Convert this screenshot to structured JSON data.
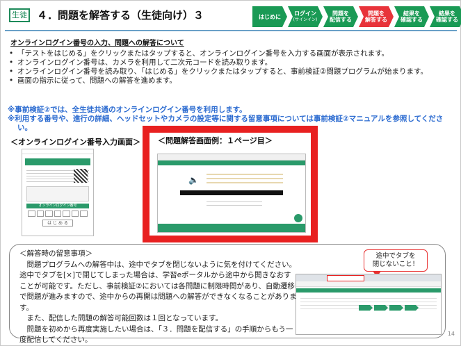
{
  "header": {
    "tag": "生徒",
    "title": "４．問題を解答する（生徒向け）３",
    "steps": [
      {
        "label": "はじめに",
        "sub": "",
        "active": false
      },
      {
        "label": "ログイン",
        "sub": "(サインイン)",
        "active": false
      },
      {
        "label": "問題を\n配信する",
        "sub": "",
        "active": false
      },
      {
        "label": "問題を\n解答する",
        "sub": "",
        "active": true
      },
      {
        "label": "結果を\n確認する",
        "sub": "",
        "active": false
      },
      {
        "label": "結果を\n確認する",
        "sub": "",
        "active": false
      }
    ]
  },
  "subtitle": "オンラインログイン番号の入力、問題への解答について",
  "bullets": [
    "「テストをはじめる」をクリックまたはタップすると、オンラインログイン番号を入力する画面が表示されます。",
    "オンラインログイン番号は、カメラを利用して二次元コードを読み取ります。",
    "オンラインログイン番号を読み取り、「はじめる」をクリックまたはタップすると、事前検証②問題プログラムが始まります。",
    "画面の指示に従って、問題への解答を進めます。"
  ],
  "notes": [
    "※事前検証②では、全生徒共通のオンラインログイン番号を利用します。",
    "※利用する番号や、進行の詳細、ヘッドセットやカメラの設定等に関する留意事項については事前検証②マニュアルを参照してください。"
  ],
  "labels": {
    "login_screen": "＜オンラインログイン番号入力画面＞",
    "question_screen": "＜問題解答画面例：１ページ目＞"
  },
  "phone": {
    "header": "オンラインログイン番号",
    "start_button": "は じ め る"
  },
  "bottom": {
    "heading": "＜解答時の留意事項＞",
    "lines": [
      "　問題プログラムへの解答中は、途中でタブを閉じないように気を付けてください。",
      "途中でタブを[×]で閉じてしまった場合は、学習eポータルから途中から開きなおすことが可能です。ただし、事前検証②においては各問題に制限時間があり、自動遷移で問題が進みますので、途中からの再開は問題への解答ができなくなることがあります。",
      "　また、配信した問題の解答可能回数は１回となっています。",
      "　問題を初めから再度実施したい場合は、「３．問題を配信する」の手順からもう一度配信してください。"
    ]
  },
  "callout": "途中でタブを\n閉じないこと！",
  "page_number": "14"
}
